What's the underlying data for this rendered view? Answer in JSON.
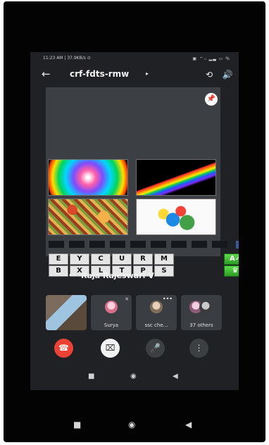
{
  "status_bar": {
    "left_text": "11:23 AM | 37.9KB/s ⊙",
    "right_text": "▣ ⌔ᵢₗ ▂▃ ▭ %"
  },
  "header": {
    "back_icon": "←",
    "title": "crf-fdts-rmw",
    "title_arrow": "▸",
    "switch_camera_icon": "⟲",
    "speaker_icon": "🔊"
  },
  "presentation": {
    "pin_icon": "📌",
    "letters_row1": [
      "E",
      "Y",
      "C",
      "U",
      "R",
      "M"
    ],
    "letters_row2": [
      "B",
      "X",
      "L",
      "T",
      "P",
      "S"
    ],
    "fb_label": "f",
    "action1": "A✓",
    "action2": "♛"
  },
  "presenter": {
    "more": "•••",
    "name": "Raja Rajeswari V"
  },
  "participants": [
    {
      "label": ""
    },
    {
      "label": "Surya"
    },
    {
      "label": "ssc che..."
    },
    {
      "label": "37 others"
    }
  ],
  "controls": {
    "end_icon": "☎",
    "camera_icon": "⌧",
    "mic_icon": "🎤",
    "more_icon": "⋮"
  },
  "nav": {
    "square": "■",
    "circle": "◉",
    "back": "◀"
  },
  "colors": {
    "end_call": "#ea4335",
    "app_background": "#202124",
    "presentation_green": "#2d9c24"
  }
}
